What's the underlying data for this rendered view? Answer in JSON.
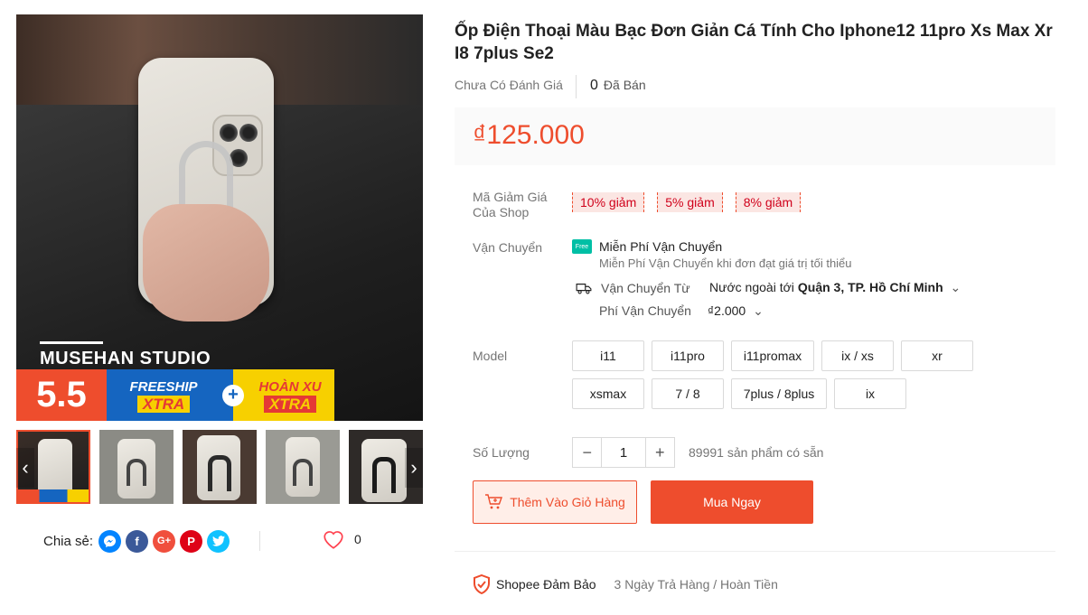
{
  "gallery": {
    "studio_name": "MUSEHAN STUDIO",
    "promo": {
      "sale": "5.5",
      "freeship": "FREESHIP",
      "xtra": "XTRA",
      "plus": "+",
      "hoanxu": "HOÀN XU",
      "xtra2": "XTRA"
    },
    "prev_arrow": "‹",
    "next_arrow": "›",
    "thumbnail_count": 5,
    "active_thumbnail": 1
  },
  "share": {
    "label": "Chia sẻ:",
    "networks": [
      "messenger",
      "facebook",
      "google-plus",
      "pinterest",
      "twitter"
    ]
  },
  "favorite": {
    "count": "0"
  },
  "product": {
    "title": "Ốp Điện Thoại Màu Bạc Đơn Giản Cá Tính Cho Iphone12 11pro Xs Max Xr I8 7plus Se2",
    "rating_text": "Chưa Có Đánh Giá",
    "sold_count": "0",
    "sold_label": "Đã Bán",
    "price": "₫125.000"
  },
  "vouchers": {
    "label_line1": "Mã Giảm Giá",
    "label_line2": "Của Shop",
    "items": [
      "10% giảm",
      "5% giảm",
      "8% giảm"
    ]
  },
  "shipping": {
    "label": "Vận Chuyển",
    "free_icon": "Free",
    "free_title": "Miễn Phí Vận Chuyển",
    "free_sub": "Miễn Phí Vận Chuyển khi đơn đạt giá trị tối thiểu",
    "from_label": "Vận Chuyển Từ",
    "from_value": "Nước ngoài tới",
    "from_dest": "Quận 3, TP. Hồ Chí Minh",
    "fee_label": "Phí Vận Chuyển",
    "fee_value": "₫2.000"
  },
  "model": {
    "label": "Model",
    "options": [
      "i11",
      "i11pro",
      "i11promax",
      "ix / xs",
      "xr",
      "xsmax",
      "7 / 8",
      "7plus / 8plus",
      "ix"
    ]
  },
  "quantity": {
    "label": "Số Lượng",
    "minus": "−",
    "value": "1",
    "plus": "+",
    "stock": "89991 sản phẩm có sẵn"
  },
  "actions": {
    "add_to_cart": "Thêm Vào Giỏ Hàng",
    "buy_now": "Mua Ngay"
  },
  "guarantee": {
    "title": "Shopee Đảm Bảo",
    "text": "3 Ngày Trả Hàng / Hoàn Tiền"
  },
  "colors": {
    "accent": "#ee4d2d",
    "voucher_bg": "#fbe6e3",
    "voucher_text": "#d0011b"
  }
}
